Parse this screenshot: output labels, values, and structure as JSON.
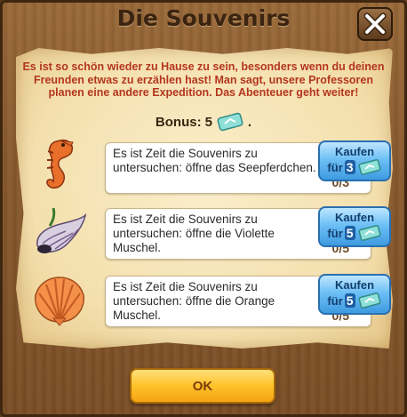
{
  "dialog": {
    "title": "Die Souvenirs",
    "close_icon": "close-icon",
    "intro": "Es ist so schön wieder zu Hause zu sein, besonders wenn du deinen Freunden etwas zu erzählen hast! Man sagt, unsere Professoren planen eine andere Expedition. Das Abenteuer geht weiter!",
    "bonus_label": "Bonus:",
    "bonus_value": "5",
    "bonus_icon": "ticket-icon",
    "bonus_suffix": ".",
    "ok_label": "OK"
  },
  "tasks": [
    {
      "icon": "seahorse-icon",
      "text": "Es ist Zeit die Souvenirs zu untersuchen: öffne das Seepferdchen.",
      "progress": "0/3",
      "buy_label": "Kaufen",
      "buy_prefix": "für",
      "buy_price": "3",
      "buy_icon": "ticket-icon"
    },
    {
      "icon": "violet-shell-icon",
      "text": "Es ist Zeit die Souvenirs zu untersuchen: öffne die Violette Muschel.",
      "progress": "0/5",
      "buy_label": "Kaufen",
      "buy_prefix": "für",
      "buy_price": "5",
      "buy_icon": "ticket-icon"
    },
    {
      "icon": "orange-shell-icon",
      "text": "Es ist Zeit die Souvenirs zu untersuchen: öffne die Orange Muschel.",
      "progress": "0/5",
      "buy_label": "Kaufen",
      "buy_prefix": "für",
      "buy_price": "5",
      "buy_icon": "ticket-icon"
    }
  ],
  "colors": {
    "intro_text": "#b4361f",
    "button_blue": "#6ec0f5",
    "button_ok": "#ffc22a"
  }
}
